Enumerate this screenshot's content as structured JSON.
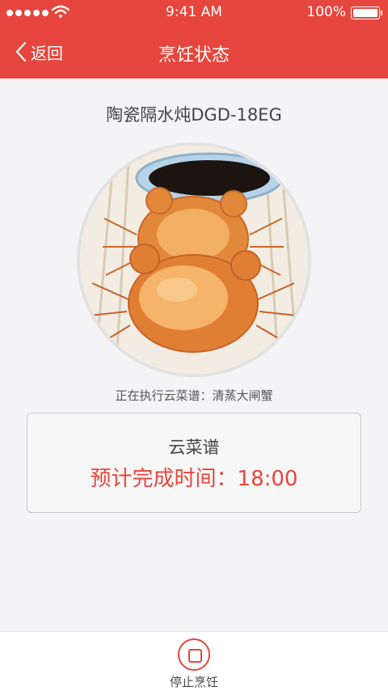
{
  "status_bar": {
    "time": "9:41 AM",
    "battery": "100%",
    "signal_icon": "signal-dots-icon",
    "wifi_icon": "wifi-icon",
    "battery_icon": "battery-icon"
  },
  "nav": {
    "back_label": "返回",
    "back_icon": "chevron-left-icon",
    "title": "烹饪状态"
  },
  "device": {
    "name": "陶瓷隔水炖DGD-18EG"
  },
  "status": {
    "running_text": "正在执行云菜谱：清蒸大闸蟹"
  },
  "recipe_card": {
    "label": "云菜谱",
    "finish_time": "预计完成时间：18:00"
  },
  "bottom": {
    "stop_label": "停止烹饪",
    "stop_icon": "stop-icon"
  },
  "colors": {
    "brand": "#e6463d",
    "background": "#f4f4f6"
  }
}
